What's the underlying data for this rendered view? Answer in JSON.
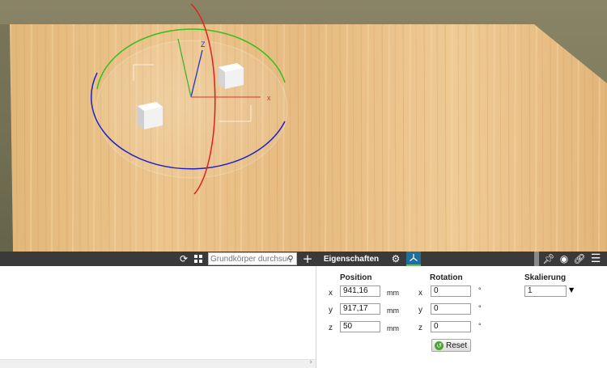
{
  "toolbar": {
    "search_placeholder": "Grundkörper durchsuchen",
    "properties_tab": "Eigenschaften",
    "icons": [
      "refresh-icon",
      "grid-icon",
      "search-icon",
      "plus-icon",
      "gear-icon",
      "transform-icon",
      "pin-icon",
      "eye-icon",
      "link-icon",
      "menu-icon"
    ]
  },
  "properties": {
    "position": {
      "header": "Position",
      "x_label": "x",
      "y_label": "y",
      "z_label": "z",
      "x": "941,16",
      "y": "917,17",
      "z": "50",
      "unit": "mm"
    },
    "rotation": {
      "header": "Rotation",
      "x_label": "x",
      "y_label": "y",
      "z_label": "z",
      "x": "0",
      "y": "0",
      "z": "0",
      "unit": "°"
    },
    "scale": {
      "header": "Skalierung",
      "value": "1"
    },
    "reset_label": "Reset"
  },
  "viewport": {
    "gizmo_axis_label": "Z",
    "gizmo_x_label": "x",
    "colors": {
      "x_axis": "#e03030",
      "y_axis": "#3bb52b",
      "z_axis": "#2233cc",
      "ring_x": "#e02020",
      "ring_y": "#33c020",
      "ring_z": "#2020c8"
    }
  }
}
